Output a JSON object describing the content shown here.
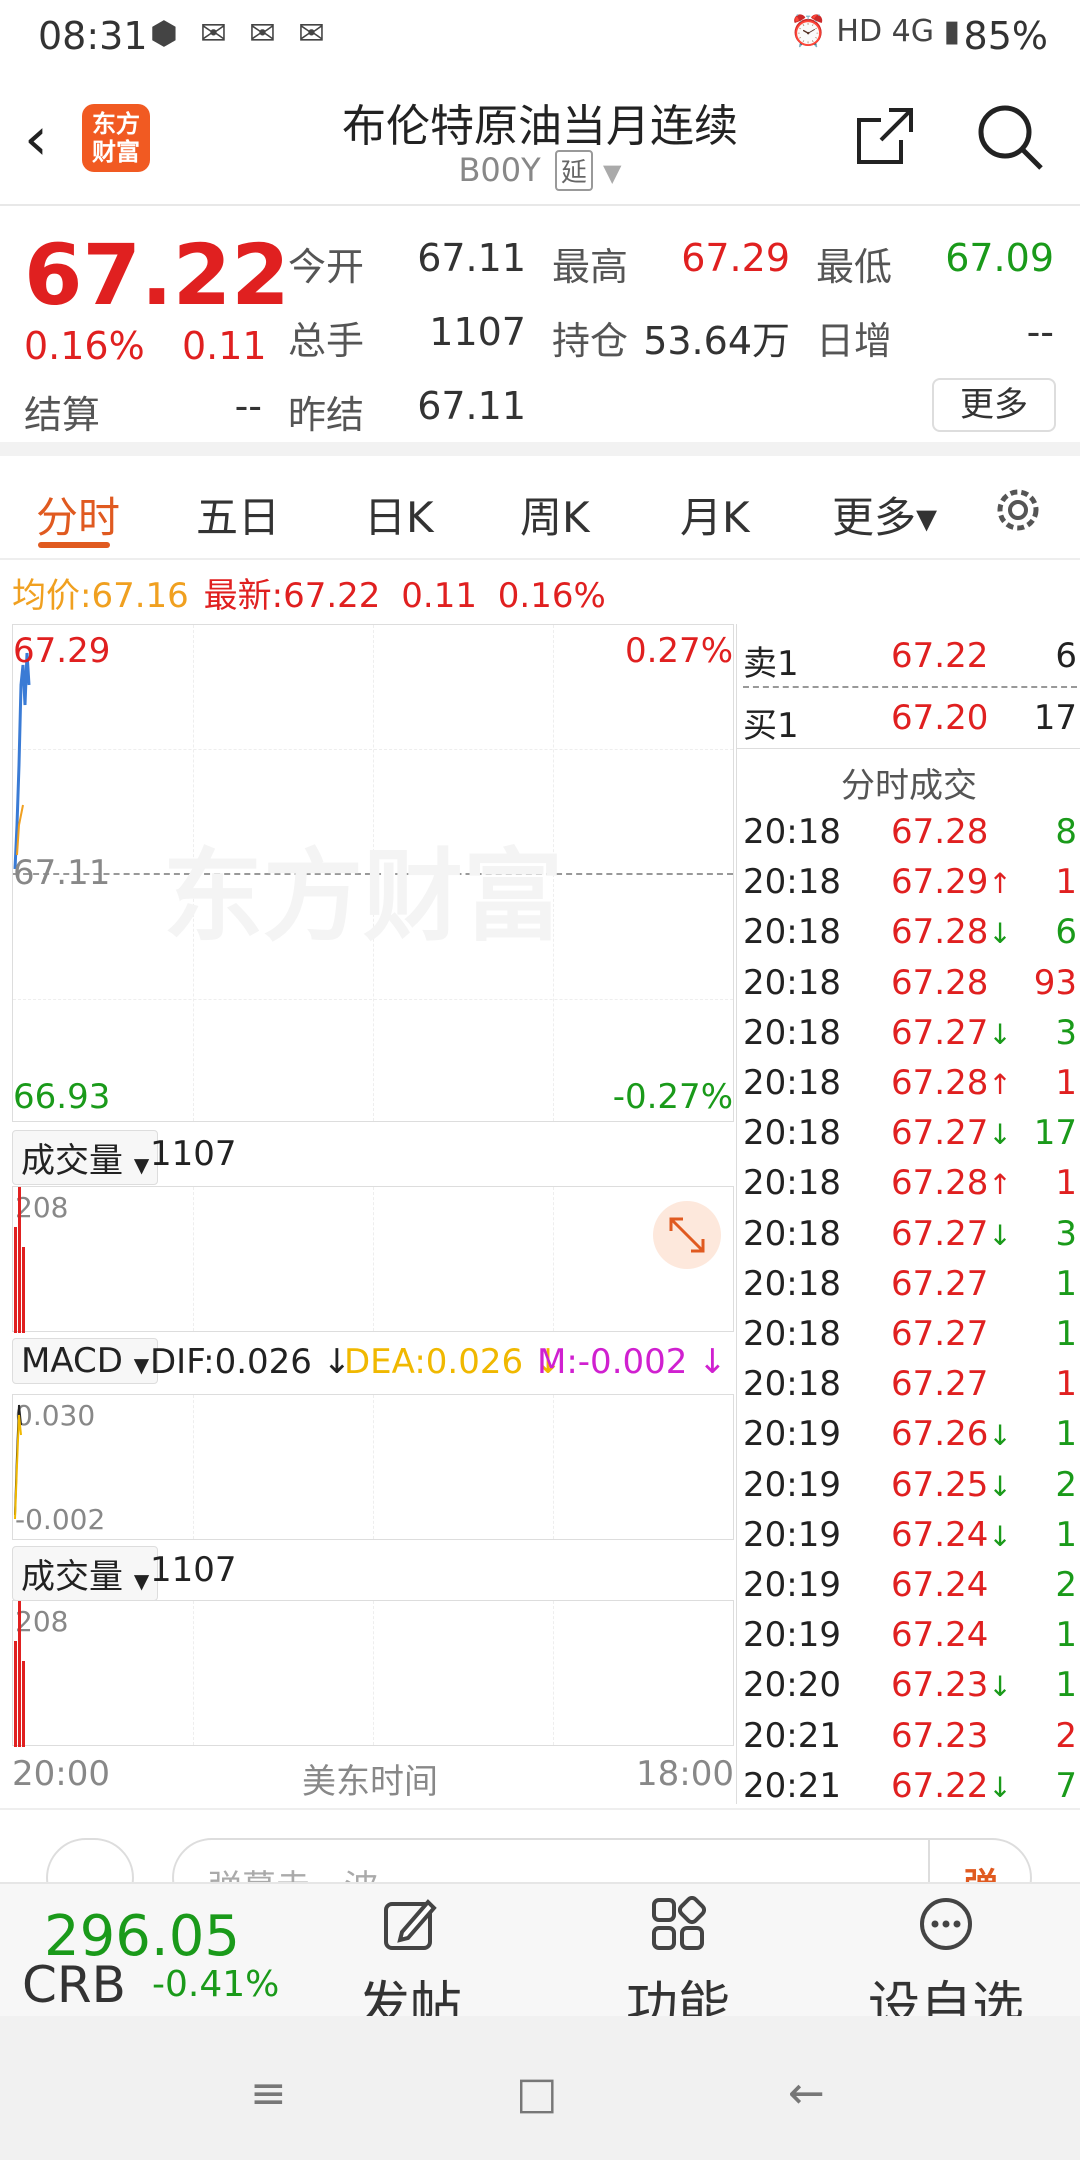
{
  "status_bar": {
    "time": "08:31",
    "notification_icons": [
      "app-icon",
      "wechat-icon",
      "wechat-icon",
      "wechat-icon"
    ],
    "right_icons": [
      "alarm-icon",
      "hd-icon",
      "4g-signal-icon"
    ],
    "battery": "85%"
  },
  "header": {
    "logo_text": "东方财富",
    "title": "布伦特原油当月连续",
    "code": "B00Y",
    "delay_tag": "延"
  },
  "quote": {
    "price": "67.22",
    "change_pct": "0.16%",
    "change": "0.11",
    "fields": {
      "open_label": "今开",
      "open": "67.11",
      "high_label": "最高",
      "high": "67.29",
      "low_label": "最低",
      "low": "67.09",
      "volume_label": "总手",
      "volume": "1107",
      "oi_label": "持仓",
      "oi": "53.64万",
      "daily_inc_label": "日增",
      "daily_inc": "--",
      "settle_label": "结算",
      "settle": "--",
      "prev_settle_label": "昨结",
      "prev_settle": "67.11"
    },
    "more_label": "更多"
  },
  "tabs": [
    {
      "label": "分时",
      "active": true
    },
    {
      "label": "五日"
    },
    {
      "label": "日K"
    },
    {
      "label": "周K"
    },
    {
      "label": "月K"
    },
    {
      "label": "更多▾"
    }
  ],
  "info_line": {
    "avg_label": "均价:",
    "avg": "67.16",
    "latest_label": "最新:",
    "latest": "67.22",
    "change": "0.11",
    "change_pct": "0.16%"
  },
  "chart": {
    "watermark": "东方财富",
    "y_max": "67.29",
    "y_min": "66.93",
    "y_mid": "67.11",
    "pct_max": "0.27%",
    "pct_min": "-0.27%",
    "volume_selector": "成交量",
    "volume_value": "1107",
    "volume_max": "208",
    "macd_selector": "MACD",
    "dif": "DIF:0.026",
    "dea": "DEA:0.026",
    "m": "M:-0.002",
    "macd_max": "0.030",
    "macd_min": "-0.002",
    "volume2_selector": "成交量",
    "volume2_value": "1107",
    "volume2_max": "208",
    "x_start": "20:00",
    "x_mid": "美东时间",
    "x_end": "18:00",
    "colors": {
      "price_line": "#3a7bd5",
      "avg_line": "#f0a020",
      "volume": "#e02020"
    }
  },
  "order_book": {
    "ask": {
      "label": "卖1",
      "price": "67.22",
      "volume": "6"
    },
    "bid": {
      "label": "买1",
      "price": "67.20",
      "volume": "17"
    },
    "trades_title": "分时成交",
    "trades": [
      {
        "time": "20:18",
        "price": "67.28",
        "arrow": "",
        "vol": "8",
        "vol_color": "green"
      },
      {
        "time": "20:18",
        "price": "67.29",
        "arrow": "↑",
        "vol": "1",
        "vol_color": "red"
      },
      {
        "time": "20:18",
        "price": "67.28",
        "arrow": "↓",
        "vol": "6",
        "vol_color": "green"
      },
      {
        "time": "20:18",
        "price": "67.28",
        "arrow": "",
        "vol": "93",
        "vol_color": "red"
      },
      {
        "time": "20:18",
        "price": "67.27",
        "arrow": "↓",
        "vol": "3",
        "vol_color": "green"
      },
      {
        "time": "20:18",
        "price": "67.28",
        "arrow": "↑",
        "vol": "1",
        "vol_color": "red"
      },
      {
        "time": "20:18",
        "price": "67.27",
        "arrow": "↓",
        "vol": "17",
        "vol_color": "green"
      },
      {
        "time": "20:18",
        "price": "67.28",
        "arrow": "↑",
        "vol": "1",
        "vol_color": "red"
      },
      {
        "time": "20:18",
        "price": "67.27",
        "arrow": "↓",
        "vol": "3",
        "vol_color": "green"
      },
      {
        "time": "20:18",
        "price": "67.27",
        "arrow": "",
        "vol": "1",
        "vol_color": "green"
      },
      {
        "time": "20:18",
        "price": "67.27",
        "arrow": "",
        "vol": "1",
        "vol_color": "green"
      },
      {
        "time": "20:18",
        "price": "67.27",
        "arrow": "",
        "vol": "1",
        "vol_color": "red"
      },
      {
        "time": "20:19",
        "price": "67.26",
        "arrow": "↓",
        "vol": "1",
        "vol_color": "green"
      },
      {
        "time": "20:19",
        "price": "67.25",
        "arrow": "↓",
        "vol": "2",
        "vol_color": "green"
      },
      {
        "time": "20:19",
        "price": "67.24",
        "arrow": "↓",
        "vol": "1",
        "vol_color": "green"
      },
      {
        "time": "20:19",
        "price": "67.24",
        "arrow": "",
        "vol": "2",
        "vol_color": "green"
      },
      {
        "time": "20:19",
        "price": "67.24",
        "arrow": "",
        "vol": "1",
        "vol_color": "green"
      },
      {
        "time": "20:20",
        "price": "67.23",
        "arrow": "↓",
        "vol": "1",
        "vol_color": "green"
      },
      {
        "time": "20:21",
        "price": "67.23",
        "arrow": "",
        "vol": "2",
        "vol_color": "red"
      },
      {
        "time": "20:21",
        "price": "67.22",
        "arrow": "↓",
        "vol": "7",
        "vol_color": "green"
      }
    ]
  },
  "comment_bar": {
    "placeholder": "弹幕走一波",
    "danmu_label": "弹"
  },
  "toolbar": {
    "index_value": "296.05",
    "index_name": "CRB",
    "index_pct": "-0.41%",
    "post_label": "发帖",
    "func_label": "功能",
    "watch_label": "设自选"
  },
  "nav_bar": {
    "menu": "≡",
    "home": "□",
    "back": "←"
  }
}
